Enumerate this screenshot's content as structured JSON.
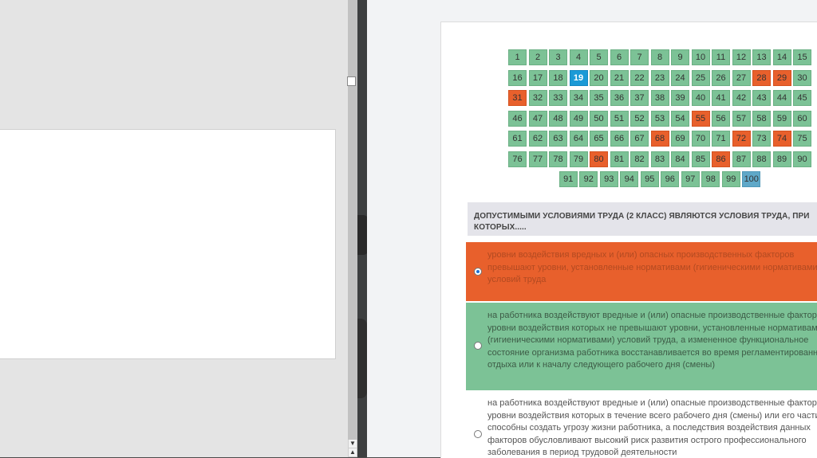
{
  "left_scrollbar": {
    "up_arrow": "▲",
    "down_arrow": "▼"
  },
  "grid": {
    "cells": [
      {
        "n": "1",
        "s": "ok"
      },
      {
        "n": "2",
        "s": "ok"
      },
      {
        "n": "3",
        "s": "ok"
      },
      {
        "n": "4",
        "s": "ok"
      },
      {
        "n": "5",
        "s": "ok"
      },
      {
        "n": "6",
        "s": "ok"
      },
      {
        "n": "7",
        "s": "ok"
      },
      {
        "n": "8",
        "s": "ok"
      },
      {
        "n": "9",
        "s": "ok"
      },
      {
        "n": "10",
        "s": "ok"
      },
      {
        "n": "11",
        "s": "ok"
      },
      {
        "n": "12",
        "s": "ok"
      },
      {
        "n": "13",
        "s": "ok"
      },
      {
        "n": "14",
        "s": "ok"
      },
      {
        "n": "15",
        "s": "ok"
      },
      {
        "n": "16",
        "s": "ok"
      },
      {
        "n": "17",
        "s": "ok"
      },
      {
        "n": "18",
        "s": "ok"
      },
      {
        "n": "19",
        "s": "current"
      },
      {
        "n": "20",
        "s": "ok"
      },
      {
        "n": "21",
        "s": "ok"
      },
      {
        "n": "22",
        "s": "ok"
      },
      {
        "n": "23",
        "s": "ok"
      },
      {
        "n": "24",
        "s": "ok"
      },
      {
        "n": "25",
        "s": "ok"
      },
      {
        "n": "26",
        "s": "ok"
      },
      {
        "n": "27",
        "s": "ok"
      },
      {
        "n": "28",
        "s": "wrong"
      },
      {
        "n": "29",
        "s": "wrong"
      },
      {
        "n": "30",
        "s": "ok"
      },
      {
        "n": "31",
        "s": "wrong"
      },
      {
        "n": "32",
        "s": "ok"
      },
      {
        "n": "33",
        "s": "ok"
      },
      {
        "n": "34",
        "s": "ok"
      },
      {
        "n": "35",
        "s": "ok"
      },
      {
        "n": "36",
        "s": "ok"
      },
      {
        "n": "37",
        "s": "ok"
      },
      {
        "n": "38",
        "s": "ok"
      },
      {
        "n": "39",
        "s": "ok"
      },
      {
        "n": "40",
        "s": "ok"
      },
      {
        "n": "41",
        "s": "ok"
      },
      {
        "n": "42",
        "s": "ok"
      },
      {
        "n": "43",
        "s": "ok"
      },
      {
        "n": "44",
        "s": "ok"
      },
      {
        "n": "45",
        "s": "ok"
      },
      {
        "n": "46",
        "s": "ok"
      },
      {
        "n": "47",
        "s": "ok"
      },
      {
        "n": "48",
        "s": "ok"
      },
      {
        "n": "49",
        "s": "ok"
      },
      {
        "n": "50",
        "s": "ok"
      },
      {
        "n": "51",
        "s": "ok"
      },
      {
        "n": "52",
        "s": "ok"
      },
      {
        "n": "53",
        "s": "ok"
      },
      {
        "n": "54",
        "s": "ok"
      },
      {
        "n": "55",
        "s": "wrong"
      },
      {
        "n": "56",
        "s": "ok"
      },
      {
        "n": "57",
        "s": "ok"
      },
      {
        "n": "58",
        "s": "ok"
      },
      {
        "n": "59",
        "s": "ok"
      },
      {
        "n": "60",
        "s": "ok"
      },
      {
        "n": "61",
        "s": "ok"
      },
      {
        "n": "62",
        "s": "ok"
      },
      {
        "n": "63",
        "s": "ok"
      },
      {
        "n": "64",
        "s": "ok"
      },
      {
        "n": "65",
        "s": "ok"
      },
      {
        "n": "66",
        "s": "ok"
      },
      {
        "n": "67",
        "s": "ok"
      },
      {
        "n": "68",
        "s": "wrong"
      },
      {
        "n": "69",
        "s": "ok"
      },
      {
        "n": "70",
        "s": "ok"
      },
      {
        "n": "71",
        "s": "ok"
      },
      {
        "n": "72",
        "s": "wrong"
      },
      {
        "n": "73",
        "s": "ok"
      },
      {
        "n": "74",
        "s": "wrong"
      },
      {
        "n": "75",
        "s": "ok"
      },
      {
        "n": "76",
        "s": "ok"
      },
      {
        "n": "77",
        "s": "ok"
      },
      {
        "n": "78",
        "s": "ok"
      },
      {
        "n": "79",
        "s": "ok"
      },
      {
        "n": "80",
        "s": "wrong"
      },
      {
        "n": "81",
        "s": "ok"
      },
      {
        "n": "82",
        "s": "ok"
      },
      {
        "n": "83",
        "s": "ok"
      },
      {
        "n": "84",
        "s": "ok"
      },
      {
        "n": "85",
        "s": "ok"
      },
      {
        "n": "86",
        "s": "wrong"
      },
      {
        "n": "87",
        "s": "ok"
      },
      {
        "n": "88",
        "s": "ok"
      },
      {
        "n": "89",
        "s": "ok"
      },
      {
        "n": "90",
        "s": "ok"
      },
      {
        "n": "91",
        "s": "ok"
      },
      {
        "n": "92",
        "s": "ok"
      },
      {
        "n": "93",
        "s": "ok"
      },
      {
        "n": "94",
        "s": "ok"
      },
      {
        "n": "95",
        "s": "ok"
      },
      {
        "n": "96",
        "s": "ok"
      },
      {
        "n": "97",
        "s": "ok"
      },
      {
        "n": "98",
        "s": "ok"
      },
      {
        "n": "99",
        "s": "ok"
      },
      {
        "n": "100",
        "s": "last"
      }
    ]
  },
  "question": {
    "line1": "ДОПУСТИМЫМИ УСЛОВИЯМИ ТРУДА (2 КЛАСС) ЯВЛЯЮТСЯ УСЛОВИЯ ТРУДА, ПРИ",
    "line2": "КОТОРЫХ....."
  },
  "answers": [
    {
      "lines": [
        "уровни воздействия вредных и (или) опасных производственных факторов",
        "превышают уровни, установленные нормативами (гигиеническими нормативами)",
        "условий труда"
      ],
      "checked": true
    },
    {
      "lines": [
        "на работника воздействуют вредные и (или) опасные производственные факторы,",
        "уровни воздействия которых не превышают уровни, установленные нормативами",
        "(гигиеническими нормативами) условий труда, а измененное функциональное",
        "состояние организма работника восстанавливается во время регламентированного",
        "отдыха или к началу следующего рабочего дня (смены)"
      ],
      "checked": false
    },
    {
      "lines": [
        "на работника воздействуют вредные и (или) опасные производственные факторы,",
        "уровни воздействия которых в течение всего рабочего дня (смены) или его части",
        "способны создать угрозу жизни работника, а последствия воздействия данных",
        "факторов обусловливают высокий риск развития острого профессионального",
        "заболевания в период трудовой деятельности"
      ],
      "checked": false
    }
  ],
  "colors": {
    "correct": "#7cc296",
    "wrong": "#e8602c",
    "current": "#1b9ad6",
    "last": "#5fa8c8"
  }
}
